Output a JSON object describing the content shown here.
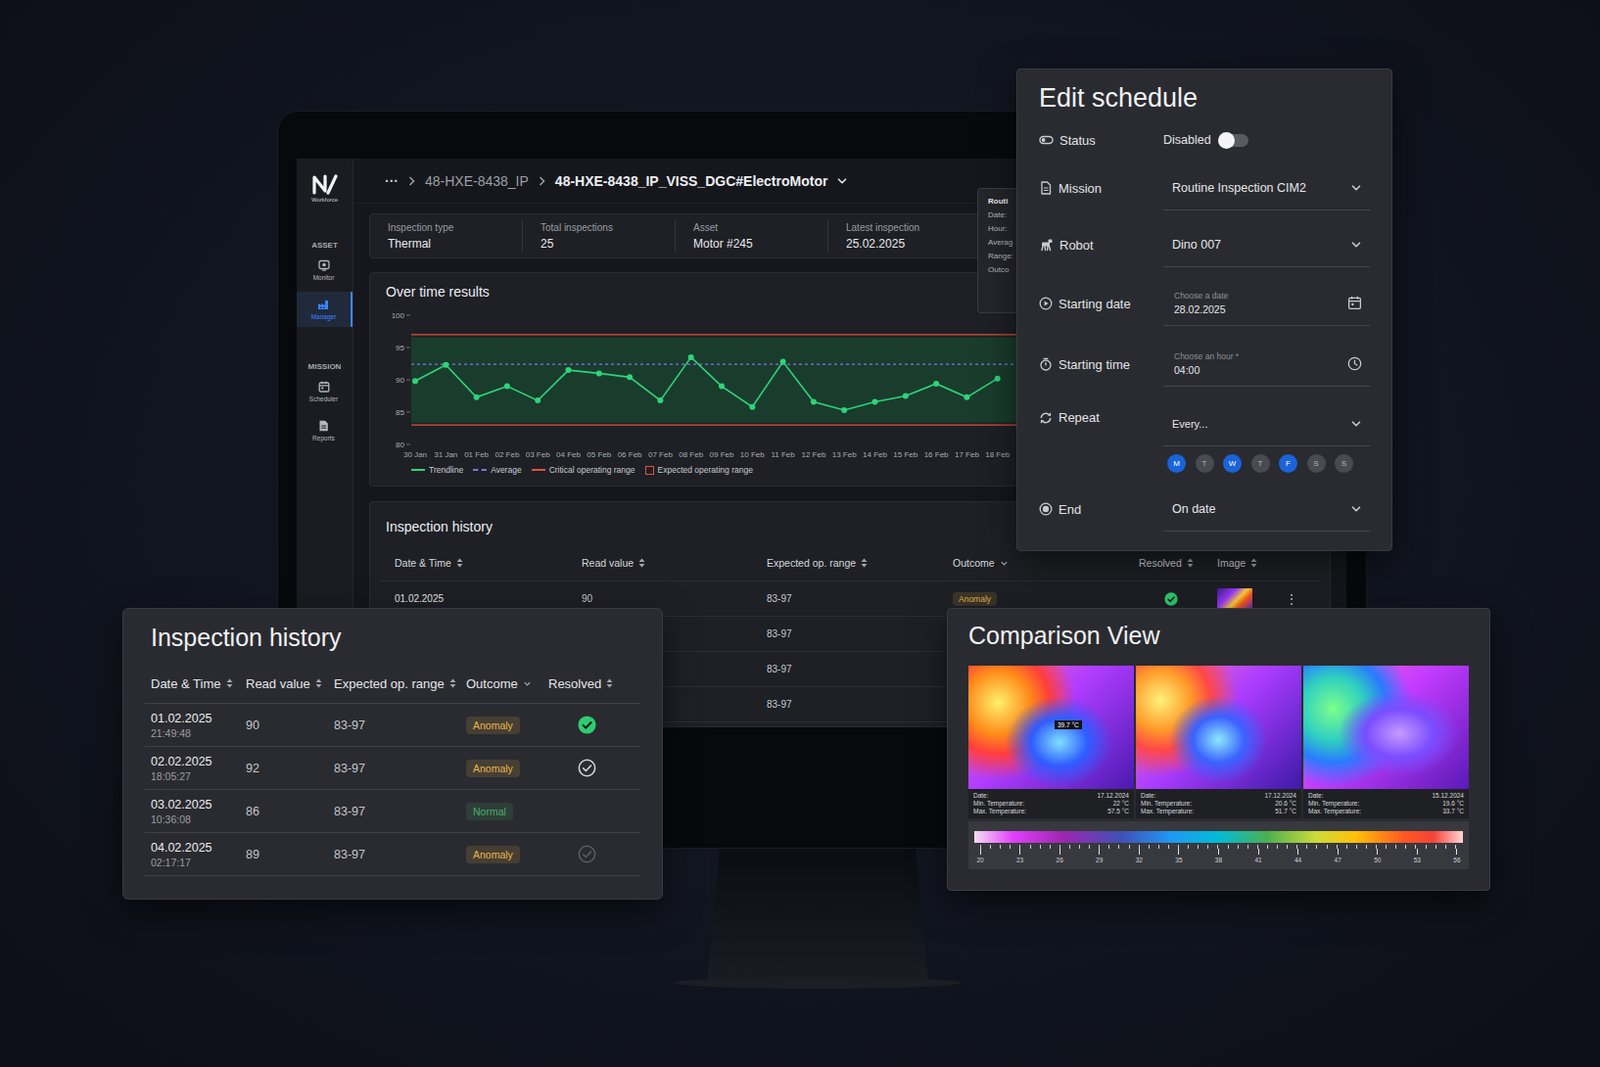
{
  "dashboard": {
    "sidebar": {
      "logo_text": "Workforce",
      "sections": [
        {
          "title": "ASSET",
          "items": [
            {
              "label": "Monitor",
              "selected": false
            },
            {
              "label": "Manager",
              "selected": true
            }
          ]
        },
        {
          "title": "MISSION",
          "items": [
            {
              "label": "Scheduler",
              "selected": false
            },
            {
              "label": "Reports",
              "selected": false
            }
          ]
        }
      ]
    },
    "breadcrumb": {
      "more": "···",
      "items": [
        "48-HXE-8438_IP",
        "48-HXE-8438_IP_VISS_DGC#ElectroMotor"
      ]
    },
    "stats": [
      {
        "label": "Inspection type",
        "value": "Thermal"
      },
      {
        "label": "Total inspections",
        "value": "25"
      },
      {
        "label": "Asset",
        "value": "Motor #245"
      },
      {
        "label": "Latest inspection",
        "value": "25.02.2025"
      }
    ],
    "chart": {
      "title": "Over time results",
      "y_ticks": [
        "100",
        "95",
        "90",
        "85",
        "80"
      ],
      "x_labels": [
        "30 Jan",
        "31 Jan",
        "01 Feb",
        "02 Feb",
        "03 Feb",
        "04 Feb",
        "05 Feb",
        "06 Feb",
        "07 Feb",
        "08 Feb",
        "09 Feb",
        "10 Feb",
        "11 Feb",
        "12 Feb",
        "13 Feb",
        "14 Feb",
        "15 Feb",
        "16 Feb",
        "17 Feb",
        "18 Feb"
      ],
      "trendline": [
        89.8,
        92.3,
        87.3,
        89,
        86.8,
        91.5,
        91,
        90.4,
        86.8,
        93.5,
        89,
        85.8,
        92.8,
        86.6,
        85.3,
        86.6,
        87.5,
        89.4,
        87.3,
        90.2
      ],
      "average": 92.4,
      "critical_range": [
        83,
        97
      ],
      "expected_range": [
        83.4,
        96.6
      ],
      "legend": [
        {
          "label": "Trendline",
          "kind": "line",
          "color": "#2ed47a"
        },
        {
          "label": "Average",
          "kind": "dashed",
          "color": "#8f6ee0"
        },
        {
          "label": "Critical operating range",
          "kind": "line",
          "color": "#e0533d"
        },
        {
          "label": "Expected operating range",
          "kind": "box",
          "color": "#e0533d"
        }
      ]
    },
    "tooltip": {
      "title": "Routi",
      "lines": [
        "Date:",
        "Hour:",
        "Averag",
        "Range:",
        "Outco"
      ]
    },
    "history": {
      "title": "Inspection history",
      "columns": [
        {
          "label": "Date & Time",
          "kind": "sort"
        },
        {
          "label": "Read value",
          "kind": "sort"
        },
        {
          "label": "Expected op. range",
          "kind": "sort"
        },
        {
          "label": "Outcome",
          "kind": "filter"
        },
        {
          "label": "Resolved",
          "kind": "sort"
        },
        {
          "label": "Image",
          "kind": "sort"
        }
      ],
      "rows": [
        {
          "date": "01.02.2025",
          "value": "90",
          "range": "83-97",
          "outcome": "Anomaly",
          "color": "#e8b44c",
          "check": "filled",
          "has_image": true,
          "menu": "⋮"
        },
        {
          "range": "83-97"
        },
        {
          "range": "83-97"
        },
        {
          "range": "83-97"
        }
      ]
    }
  },
  "schedule": {
    "title": "Edit schedule",
    "rows": [
      {
        "kind": "toggle",
        "label": "Status",
        "value": "Disabled",
        "on": false
      },
      {
        "kind": "select",
        "label": "Mission",
        "value": "Routine Inspection CIM2"
      },
      {
        "kind": "select",
        "label": "Robot",
        "value": "Dino 007"
      },
      {
        "kind": "date",
        "label": "Starting date",
        "hint": "Choose a date",
        "value": "28.02.2025"
      },
      {
        "kind": "time",
        "label": "Starting time",
        "hint": "Choose an hour *",
        "value": "04:00"
      },
      {
        "kind": "repeat",
        "label": "Repeat",
        "value": "Every...",
        "days": [
          {
            "label": "M",
            "selected": true
          },
          {
            "label": "T",
            "selected": false
          },
          {
            "label": "W",
            "selected": true
          },
          {
            "label": "T",
            "selected": false
          },
          {
            "label": "F",
            "selected": true
          },
          {
            "label": "S",
            "selected": false
          },
          {
            "label": "S",
            "selected": false
          }
        ]
      },
      {
        "kind": "select",
        "label": "End",
        "value": "On date"
      }
    ]
  },
  "history_panel": {
    "title": "Inspection history",
    "columns": [
      {
        "label": "Date & Time",
        "kind": "sort"
      },
      {
        "label": "Read value",
        "kind": "sort"
      },
      {
        "label": "Expected op. range",
        "kind": "sort"
      },
      {
        "label": "Outcome",
        "kind": "filter"
      },
      {
        "label": "Resolved",
        "kind": "sort"
      }
    ],
    "rows": [
      {
        "date": "01.02.2025",
        "time": "21:49:48",
        "value": "90",
        "range": "83-97",
        "outcome": "Anomaly",
        "color": "#e8b44c",
        "check": "filled"
      },
      {
        "date": "02.02.2025",
        "time": "18:05:27",
        "value": "92",
        "range": "83-97",
        "outcome": "Anomaly",
        "color": "#e8b44c",
        "check": "outline"
      },
      {
        "date": "03.02.2025",
        "time": "10:36:08",
        "value": "86",
        "range": "83-97",
        "outcome": "Normal",
        "color": "#4caf6a",
        "check": "none"
      },
      {
        "date": "04.02.2025",
        "time": "02:17:17",
        "value": "89",
        "range": "83-97",
        "outcome": "Anomaly",
        "color": "#e8b44c",
        "check": "faint"
      }
    ]
  },
  "comparison": {
    "title": "Comparison View",
    "labels": {
      "date": "Date:",
      "min": "Min. Temperature:",
      "max": "Max. Temperature:"
    },
    "images": [
      {
        "date": "17.12.2024",
        "min": "22 °C",
        "max": "57.5 °C",
        "marker": "39.7 °C"
      },
      {
        "date": "17.12.2024",
        "min": "20.6 °C",
        "max": "51.7 °C"
      },
      {
        "date": "15.12.2024",
        "min": "19.6 °C",
        "max": "33.7 °C"
      }
    ],
    "scale": [
      "20",
      "23",
      "26",
      "29",
      "32",
      "35",
      "38",
      "41",
      "44",
      "47",
      "50",
      "53",
      "56"
    ]
  }
}
